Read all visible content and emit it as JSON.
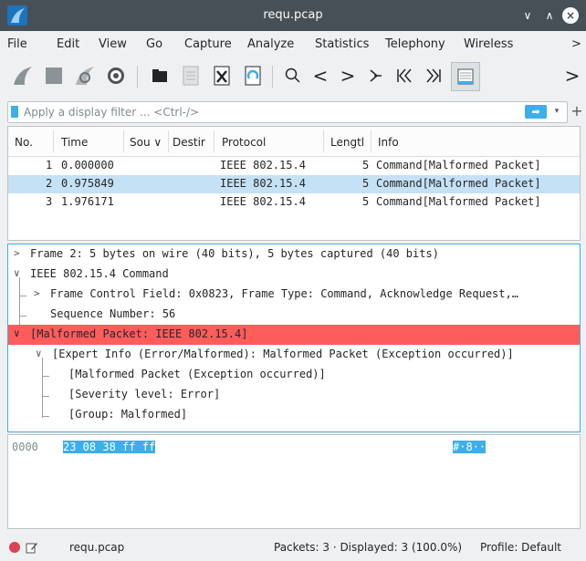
{
  "window": {
    "title": "requ.pcap"
  },
  "menu": [
    "File",
    "Edit",
    "View",
    "Go",
    "Capture",
    "Analyze",
    "Statistics",
    "Telephony",
    "Wireless",
    ">"
  ],
  "toolbar": {
    "icons": [
      "shark-fin-start-icon",
      "stop-icon",
      "restart-icon",
      "options-gear-icon",
      "open-folder-icon",
      "save-file-icon",
      "close-file-icon",
      "reload-icon",
      "search-icon",
      "back-arrow-icon",
      "forward-arrow-icon",
      "go-to-packet-icon",
      "first-packet-icon",
      "last-packet-icon",
      "autoscroll-icon",
      "more-chevron-icon"
    ],
    "back": "<",
    "forward": ">",
    "goto": ">",
    "first": "|<<",
    "last": ">>|",
    "more": ">"
  },
  "filter": {
    "placeholder": "Apply a display filter ... <Ctrl-/>",
    "apply": "➡",
    "dropdown": "▾",
    "plus": "+"
  },
  "packet_list": {
    "columns": [
      "No.",
      "Time",
      "Sou ∨",
      "Destir",
      "Protocol",
      "Lengtl",
      "Info"
    ],
    "rows": [
      {
        "no": "1",
        "time": "0.000000",
        "protocol": "IEEE 802.15.4",
        "length": "5",
        "info": "Command[Malformed Packet]",
        "selected": false
      },
      {
        "no": "2",
        "time": "0.975849",
        "protocol": "IEEE 802.15.4",
        "length": "5",
        "info": "Command[Malformed Packet]",
        "selected": true
      },
      {
        "no": "3",
        "time": "1.976171",
        "protocol": "IEEE 802.15.4",
        "length": "5",
        "info": "Command[Malformed Packet]",
        "selected": false
      }
    ]
  },
  "details": {
    "frame": "Frame 2: 5 bytes on wire (40 bits), 5 bytes captured (40 bits)",
    "ieee": "IEEE 802.15.4 Command",
    "fcf": "Frame Control Field: 0x0823, Frame Type: Command, Acknowledge Request,…",
    "seq": "Sequence Number: 56",
    "malformed": "[Malformed Packet: IEEE 802.15.4]",
    "expert": "[Expert Info (Error/Malformed): Malformed Packet (Exception occurred)]",
    "exp1": "[Malformed Packet (Exception occurred)]",
    "exp2": "[Severity level: Error]",
    "exp3": "[Group: Malformed]",
    "arrows": {
      "collapsed": ">",
      "expanded": "∨"
    }
  },
  "bytes": {
    "offset": "0000",
    "hex": "23 08 38 ff ff",
    "ascii": "#·8··"
  },
  "status": {
    "file": "requ.pcap",
    "packets": "Packets: 3 · Displayed: 3 (100.0%)",
    "profile": "Profile: Default"
  },
  "colors": {
    "accent": "#3daee9",
    "selected_row": "#c5e1f5",
    "error_row": "#ff5c5c",
    "titlebar": "#475057"
  }
}
